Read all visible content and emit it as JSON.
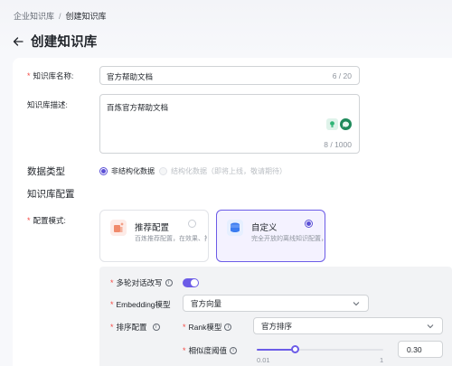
{
  "breadcrumb": {
    "parent": "企业知识库",
    "separator": "/",
    "current": "创建知识库"
  },
  "page": {
    "title": "创建知识库"
  },
  "form": {
    "name": {
      "label": "知识库名称:",
      "value": "官方帮助文档",
      "counter": "6 / 20"
    },
    "description": {
      "label": "知识库描述:",
      "value": "百炼官方帮助文档",
      "counter": "8 / 1000"
    },
    "data_type": {
      "label": "数据类型",
      "options": [
        {
          "label": "非结构化数据",
          "checked": true
        },
        {
          "label": "结构化数据（即将上线，敬请期待）",
          "checked": false
        }
      ]
    },
    "config_section_title": "知识库配置",
    "config_mode": {
      "label": "配置模式:",
      "cards": [
        {
          "title": "推荐配置",
          "desc": "百炼推荐配置，在效果、推理成本、检索时延等...",
          "selected": false
        },
        {
          "title": "自定义",
          "desc": "完全开放的离线知识配置，按照检索需求自由...",
          "selected": true
        }
      ]
    },
    "advanced": {
      "multi_turn": {
        "label": "多轮对话改写",
        "enabled": true
      },
      "embedding": {
        "label": "Embedding模型",
        "value": "官方向量"
      },
      "ranking": {
        "label": "排序配置",
        "rank_model": {
          "label": "Rank模型",
          "value": "官方排序"
        },
        "similarity": {
          "label": "相似度阈值",
          "value": "0.30",
          "min_label": "0.01",
          "max_label": "1",
          "level": 0.3
        }
      }
    }
  },
  "colors": {
    "accent": "#6c5ce7",
    "required": "#f54a45"
  }
}
